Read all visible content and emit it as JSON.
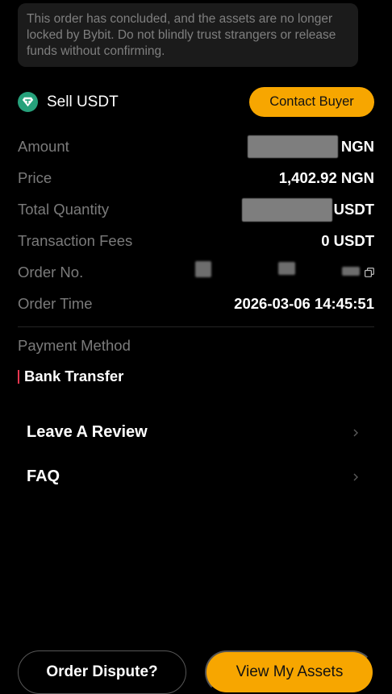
{
  "notice": {
    "text": "This order has concluded, and the assets are no longer locked by Bybit. Do not blindly trust strangers or release funds without confirming."
  },
  "order": {
    "type_label": "Sell USDT",
    "coin_icon": "tether-icon",
    "contact_label": "Contact Buyer"
  },
  "details": {
    "amount_label": "Amount",
    "amount_currency": "NGN",
    "price_label": "Price",
    "price_value": "1,402.92 NGN",
    "quantity_label": "Total Quantity",
    "quantity_currency": "USDT",
    "fees_label": "Transaction Fees",
    "fees_value": "0 USDT",
    "order_no_label": "Order No.",
    "order_time_label": "Order Time",
    "order_time_value": "2026-03-06 14:45:51"
  },
  "payment": {
    "label": "Payment Method",
    "value": "Bank Transfer"
  },
  "links": {
    "review_label": "Leave A Review",
    "faq_label": "FAQ"
  },
  "footer": {
    "dispute_label": "Order Dispute?",
    "assets_label": "View My Assets"
  },
  "colors": {
    "accent": "#f7a600",
    "background": "#000000",
    "notice_bg": "#1b1b1b",
    "muted_text": "#7b7b7b",
    "tether": "#26a17b",
    "payment_marker": "#e8364f"
  }
}
